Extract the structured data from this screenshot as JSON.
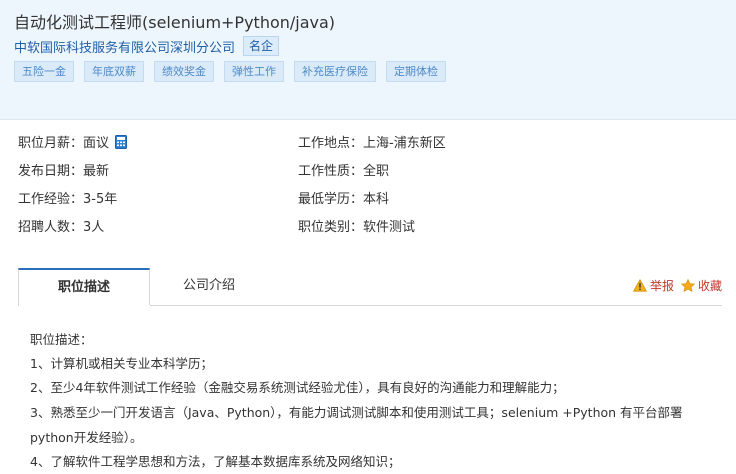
{
  "header": {
    "title": "自动化测试工程师(selenium+Python/java)",
    "company": "中软国际科技服务有限公司深圳分公司",
    "badge": "名企",
    "tags": [
      "五险一金",
      "年底双薪",
      "绩效奖金",
      "弹性工作",
      "补充医疗保险",
      "定期体检"
    ]
  },
  "info_left": [
    {
      "label": "职位月薪：",
      "value": "面议"
    },
    {
      "label": "发布日期：",
      "value": "最新"
    },
    {
      "label": "工作经验：",
      "value": "3-5年"
    },
    {
      "label": "招聘人数：",
      "value": "3人"
    }
  ],
  "info_right": [
    {
      "label": "工作地点：",
      "value": "上海-浦东新区"
    },
    {
      "label": "工作性质：",
      "value": "全职"
    },
    {
      "label": "最低学历：",
      "value": "本科"
    },
    {
      "label": "职位类别：",
      "value": "软件测试"
    }
  ],
  "tabs": {
    "active": "职位描述",
    "other": "公司介绍",
    "report": "举报",
    "favorite": "收藏"
  },
  "description": [
    "职位描述：",
    "1、计算机或相关专业本科学历；",
    "2、至少4年软件测试工作经验（金融交易系统测试经验尤佳），具有良好的沟通能力和理解能力；",
    "3、熟悉至少一门开发语言（Java、Python），有能力调试测试脚本和使用测试工具；selenium +Python 有平台部署  python开发经验）。",
    "4、了解软件工程学思想和方法，了解基本数据库系统及网络知识；"
  ],
  "colors": {
    "header_bg": "#eef6fd",
    "company_link": "#1f5fa6",
    "tag_text": "#4d8ac8",
    "tab_accent": "#2a6fba",
    "report_red": "#c0392b"
  }
}
